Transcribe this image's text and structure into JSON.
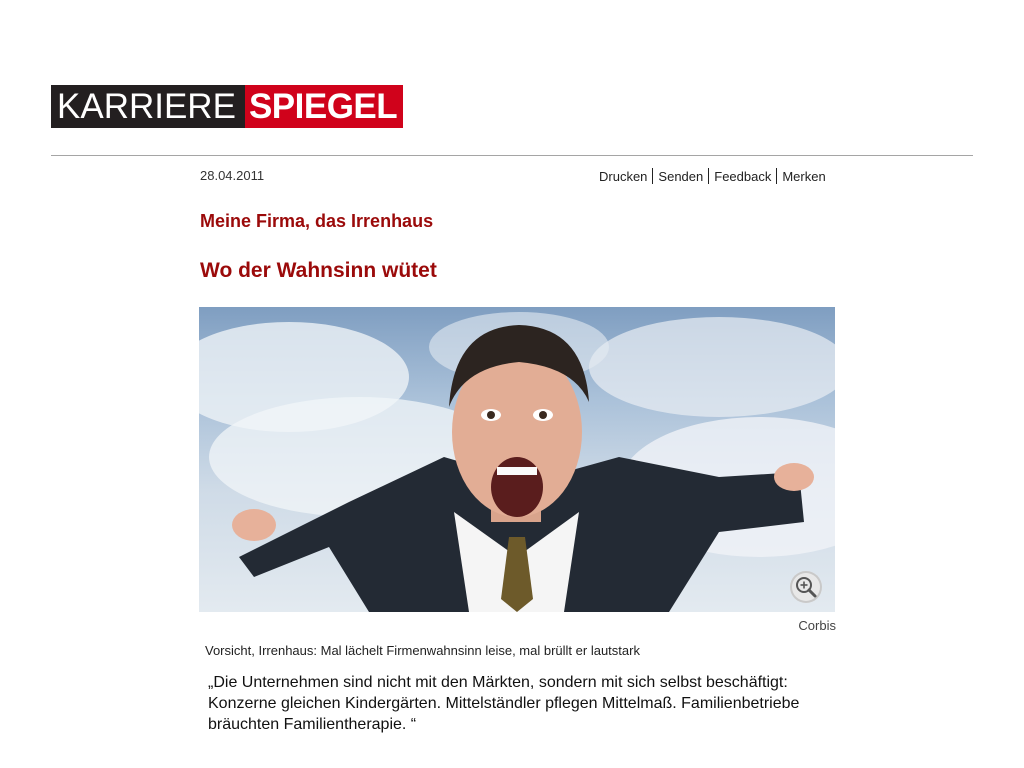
{
  "brand": {
    "part1": "KARRIERE",
    "part2": "SPIEGEL"
  },
  "article": {
    "date": "28.04.2011",
    "actions": [
      "Drucken",
      "Senden",
      "Feedback",
      "Merken"
    ],
    "kicker": "Meine Firma, das Irrenhaus",
    "headline": "Wo der Wahnsinn wütet",
    "photo_credit": "Corbis",
    "caption": "Vorsicht, Irrenhaus: Mal lächelt Firmenwahnsinn leise, mal brüllt er lautstark"
  },
  "quote": "„Die Unternehmen sind nicht mit den Märkten, sondern mit sich selbst beschäftigt: Konzerne gleichen Kindergärten. Mittelständler pflegen Mittelmaß. Familienbetriebe bräuchten Familientherapie. “",
  "colors": {
    "brand_red": "#d0021b",
    "brand_black": "#231f20",
    "headline_red": "#9b0a0a"
  },
  "icons": {
    "zoom": "magnifier-plus-icon"
  }
}
